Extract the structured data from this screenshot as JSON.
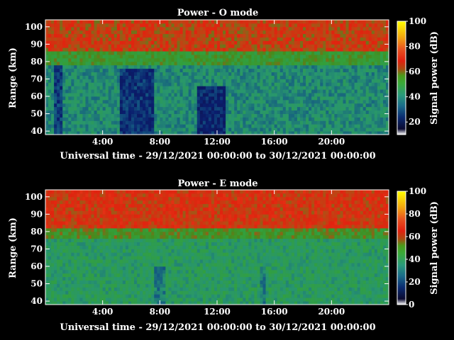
{
  "chart_data": [
    {
      "type": "heatmap",
      "title": "Power - O mode",
      "xlabel": "Universal time - 29/12/2021 00:00:00 to 30/12/2021 00:00:00",
      "ylabel": "Range (km)",
      "colorbar_label": "Signal power (dB)",
      "x_ticks": [
        "4:00",
        "8:00",
        "12:00",
        "16:00",
        "20:00"
      ],
      "x_tick_hours": [
        4,
        8,
        12,
        16,
        20
      ],
      "y_ticks": [
        40,
        50,
        60,
        70,
        80,
        90,
        100
      ],
      "xlim_hours": [
        0,
        24
      ],
      "ylim_km": [
        38,
        104
      ],
      "colorbar_ticks": [
        20,
        40,
        60,
        80,
        100
      ],
      "colorbar_range": [
        10,
        100
      ],
      "time_step_hours": 0.2,
      "range_step_km": 2,
      "layers": [
        {
          "name": "lower",
          "range_km": [
            38,
            78
          ],
          "mean_db": 33
        },
        {
          "name": "transition",
          "range_km": [
            78,
            86
          ],
          "mean_db": 48
        },
        {
          "name": "upper",
          "range_km": [
            86,
            104
          ],
          "mean_db": 60
        }
      ],
      "low_signal_bands": [
        {
          "hours": [
            0.6,
            1.2
          ],
          "range_km": [
            38,
            78
          ],
          "mean_db": 20
        },
        {
          "hours": [
            5.2,
            7.6
          ],
          "range_km": [
            38,
            76
          ],
          "mean_db": 18
        },
        {
          "hours": [
            10.4,
            12.4
          ],
          "range_km": [
            38,
            66
          ],
          "mean_db": 16
        }
      ]
    },
    {
      "type": "heatmap",
      "title": "Power - E mode",
      "xlabel": "Universal time - 29/12/2021 00:00:00 to 30/12/2021 00:00:00",
      "ylabel": "Range (km)",
      "colorbar_label": "Signal power (dB)",
      "x_ticks": [
        "4:00",
        "8:00",
        "12:00",
        "16:00",
        "20:00"
      ],
      "x_tick_hours": [
        4,
        8,
        12,
        16,
        20
      ],
      "y_ticks": [
        40,
        50,
        60,
        70,
        80,
        90,
        100
      ],
      "xlim_hours": [
        0,
        24
      ],
      "ylim_km": [
        38,
        104
      ],
      "colorbar_ticks": [
        0,
        20,
        40,
        60,
        80,
        100
      ],
      "colorbar_range": [
        0,
        100
      ],
      "time_step_hours": 0.2,
      "range_step_km": 2,
      "layers": [
        {
          "name": "lower",
          "range_km": [
            38,
            76
          ],
          "mean_db": 38
        },
        {
          "name": "transition",
          "range_km": [
            76,
            82
          ],
          "mean_db": 50
        },
        {
          "name": "upper",
          "range_km": [
            82,
            104
          ],
          "mean_db": 62
        }
      ],
      "low_signal_bands": [
        {
          "hours": [
            7.6,
            8.4
          ],
          "range_km": [
            38,
            60
          ],
          "mean_db": 30
        },
        {
          "hours": [
            14.8,
            15.2
          ],
          "range_km": [
            38,
            60
          ],
          "mean_db": 30
        }
      ]
    }
  ]
}
